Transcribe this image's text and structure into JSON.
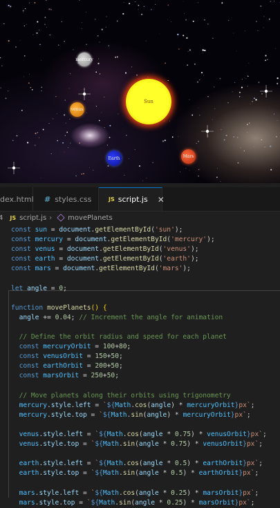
{
  "planets": {
    "sun": "Sun",
    "mercury": "mercury",
    "venus": "venus",
    "earth": "Earth",
    "mars": "Mars"
  },
  "tabs": [
    {
      "label": "dex.html",
      "icon": "html-icon"
    },
    {
      "label": "styles.css",
      "icon": "hash-icon"
    },
    {
      "label": "script.js",
      "icon": "js-icon",
      "active": true
    }
  ],
  "breadcrumb": {
    "line": "4",
    "file": "script.js",
    "symbol": "movePlanets"
  },
  "code_lines": [
    [
      {
        "c": "kw",
        "t": "const "
      },
      {
        "c": "var",
        "t": "sun"
      },
      {
        "c": "",
        "t": " = "
      },
      {
        "c": "prop",
        "t": "document"
      },
      {
        "c": "",
        "t": "."
      },
      {
        "c": "fn",
        "t": "getElementById"
      },
      {
        "c": "",
        "t": "("
      },
      {
        "c": "str",
        "t": "'sun'"
      },
      {
        "c": "",
        "t": ");"
      }
    ],
    [
      {
        "c": "kw",
        "t": "const "
      },
      {
        "c": "var",
        "t": "mercury"
      },
      {
        "c": "",
        "t": " = "
      },
      {
        "c": "prop",
        "t": "document"
      },
      {
        "c": "",
        "t": "."
      },
      {
        "c": "fn",
        "t": "getElementById"
      },
      {
        "c": "",
        "t": "("
      },
      {
        "c": "str",
        "t": "'mercury'"
      },
      {
        "c": "",
        "t": ");"
      }
    ],
    [
      {
        "c": "kw",
        "t": "const "
      },
      {
        "c": "var",
        "t": "venus"
      },
      {
        "c": "",
        "t": " = "
      },
      {
        "c": "prop",
        "t": "document"
      },
      {
        "c": "",
        "t": "."
      },
      {
        "c": "fn",
        "t": "getElementById"
      },
      {
        "c": "",
        "t": "("
      },
      {
        "c": "str",
        "t": "'venus'"
      },
      {
        "c": "",
        "t": ");"
      }
    ],
    [
      {
        "c": "kw",
        "t": "const "
      },
      {
        "c": "var",
        "t": "earth"
      },
      {
        "c": "",
        "t": " = "
      },
      {
        "c": "prop",
        "t": "document"
      },
      {
        "c": "",
        "t": "."
      },
      {
        "c": "fn",
        "t": "getElementById"
      },
      {
        "c": "",
        "t": "("
      },
      {
        "c": "str",
        "t": "'earth'"
      },
      {
        "c": "",
        "t": ");"
      }
    ],
    [
      {
        "c": "kw",
        "t": "const "
      },
      {
        "c": "var",
        "t": "mars"
      },
      {
        "c": "",
        "t": " = "
      },
      {
        "c": "prop",
        "t": "document"
      },
      {
        "c": "",
        "t": "."
      },
      {
        "c": "fn",
        "t": "getElementById"
      },
      {
        "c": "",
        "t": "("
      },
      {
        "c": "str",
        "t": "'mars'"
      },
      {
        "c": "",
        "t": ");"
      }
    ],
    [],
    [
      {
        "c": "kw",
        "t": "let "
      },
      {
        "c": "prop",
        "t": "angle"
      },
      {
        "c": "",
        "t": " = "
      },
      {
        "c": "num",
        "t": "0"
      },
      {
        "c": "",
        "t": ";"
      }
    ],
    [],
    [
      {
        "c": "kw",
        "t": "function "
      },
      {
        "c": "fn",
        "t": "movePlanets"
      },
      {
        "c": "br",
        "t": "()"
      },
      {
        "c": "",
        "t": " "
      },
      {
        "c": "br",
        "t": "{"
      }
    ],
    [
      {
        "c": "",
        "t": "  "
      },
      {
        "c": "prop",
        "t": "angle"
      },
      {
        "c": "",
        "t": " += "
      },
      {
        "c": "num",
        "t": "0.04"
      },
      {
        "c": "",
        "t": "; "
      },
      {
        "c": "cm",
        "t": "// Increment the angle for animation"
      }
    ],
    [],
    [
      {
        "c": "",
        "t": "  "
      },
      {
        "c": "cm",
        "t": "// Define the orbit radius and speed for each planet"
      }
    ],
    [
      {
        "c": "",
        "t": "  "
      },
      {
        "c": "kw",
        "t": "const "
      },
      {
        "c": "var",
        "t": "mercuryOrbit"
      },
      {
        "c": "",
        "t": " = "
      },
      {
        "c": "num",
        "t": "100"
      },
      {
        "c": "",
        "t": "+"
      },
      {
        "c": "num",
        "t": "80"
      },
      {
        "c": "",
        "t": ";"
      }
    ],
    [
      {
        "c": "",
        "t": "  "
      },
      {
        "c": "kw",
        "t": "const "
      },
      {
        "c": "var",
        "t": "venusOrbit"
      },
      {
        "c": "",
        "t": " = "
      },
      {
        "c": "num",
        "t": "150"
      },
      {
        "c": "",
        "t": "+"
      },
      {
        "c": "num",
        "t": "50"
      },
      {
        "c": "",
        "t": ";"
      }
    ],
    [
      {
        "c": "",
        "t": "  "
      },
      {
        "c": "kw",
        "t": "const "
      },
      {
        "c": "var",
        "t": "earthOrbit"
      },
      {
        "c": "",
        "t": " = "
      },
      {
        "c": "num",
        "t": "200"
      },
      {
        "c": "",
        "t": "+"
      },
      {
        "c": "num",
        "t": "50"
      },
      {
        "c": "",
        "t": ";"
      }
    ],
    [
      {
        "c": "",
        "t": "  "
      },
      {
        "c": "kw",
        "t": "const "
      },
      {
        "c": "var",
        "t": "marsOrbit"
      },
      {
        "c": "",
        "t": " = "
      },
      {
        "c": "num",
        "t": "250"
      },
      {
        "c": "",
        "t": "+"
      },
      {
        "c": "num",
        "t": "50"
      },
      {
        "c": "",
        "t": ";"
      }
    ],
    [],
    [
      {
        "c": "",
        "t": "  "
      },
      {
        "c": "cm",
        "t": "// Move planets along their orbits using trigonometry"
      }
    ],
    [
      {
        "c": "",
        "t": "  "
      },
      {
        "c": "var",
        "t": "mercury"
      },
      {
        "c": "",
        "t": "."
      },
      {
        "c": "prop",
        "t": "style"
      },
      {
        "c": "",
        "t": "."
      },
      {
        "c": "prop",
        "t": "left"
      },
      {
        "c": "",
        "t": " = "
      },
      {
        "c": "str",
        "t": "`"
      },
      {
        "c": "kw",
        "t": "${"
      },
      {
        "c": "var",
        "t": "Math"
      },
      {
        "c": "",
        "t": "."
      },
      {
        "c": "fn",
        "t": "cos"
      },
      {
        "c": "",
        "t": "("
      },
      {
        "c": "prop",
        "t": "angle"
      },
      {
        "c": "",
        "t": ") * "
      },
      {
        "c": "var",
        "t": "mercuryOrbit"
      },
      {
        "c": "kw",
        "t": "}"
      },
      {
        "c": "str",
        "t": "px`"
      },
      {
        "c": "",
        "t": ";"
      }
    ],
    [
      {
        "c": "",
        "t": "  "
      },
      {
        "c": "var",
        "t": "mercury"
      },
      {
        "c": "",
        "t": "."
      },
      {
        "c": "prop",
        "t": "style"
      },
      {
        "c": "",
        "t": "."
      },
      {
        "c": "prop",
        "t": "top"
      },
      {
        "c": "",
        "t": " = "
      },
      {
        "c": "str",
        "t": "`"
      },
      {
        "c": "kw",
        "t": "${"
      },
      {
        "c": "var",
        "t": "Math"
      },
      {
        "c": "",
        "t": "."
      },
      {
        "c": "fn",
        "t": "sin"
      },
      {
        "c": "",
        "t": "("
      },
      {
        "c": "prop",
        "t": "angle"
      },
      {
        "c": "",
        "t": ") * "
      },
      {
        "c": "var",
        "t": "mercuryOrbit"
      },
      {
        "c": "kw",
        "t": "}"
      },
      {
        "c": "str",
        "t": "px`"
      },
      {
        "c": "",
        "t": ";"
      }
    ],
    [],
    [
      {
        "c": "",
        "t": "  "
      },
      {
        "c": "var",
        "t": "venus"
      },
      {
        "c": "",
        "t": "."
      },
      {
        "c": "prop",
        "t": "style"
      },
      {
        "c": "",
        "t": "."
      },
      {
        "c": "prop",
        "t": "left"
      },
      {
        "c": "",
        "t": " = "
      },
      {
        "c": "str",
        "t": "`"
      },
      {
        "c": "kw",
        "t": "${"
      },
      {
        "c": "var",
        "t": "Math"
      },
      {
        "c": "",
        "t": "."
      },
      {
        "c": "fn",
        "t": "cos"
      },
      {
        "c": "",
        "t": "("
      },
      {
        "c": "prop",
        "t": "angle"
      },
      {
        "c": "",
        "t": " * "
      },
      {
        "c": "num",
        "t": "0.75"
      },
      {
        "c": "",
        "t": ") * "
      },
      {
        "c": "var",
        "t": "venusOrbit"
      },
      {
        "c": "kw",
        "t": "}"
      },
      {
        "c": "str",
        "t": "px`"
      },
      {
        "c": "",
        "t": ";"
      }
    ],
    [
      {
        "c": "",
        "t": "  "
      },
      {
        "c": "var",
        "t": "venus"
      },
      {
        "c": "",
        "t": "."
      },
      {
        "c": "prop",
        "t": "style"
      },
      {
        "c": "",
        "t": "."
      },
      {
        "c": "prop",
        "t": "top"
      },
      {
        "c": "",
        "t": " = "
      },
      {
        "c": "str",
        "t": "`"
      },
      {
        "c": "kw",
        "t": "${"
      },
      {
        "c": "var",
        "t": "Math"
      },
      {
        "c": "",
        "t": "."
      },
      {
        "c": "fn",
        "t": "sin"
      },
      {
        "c": "",
        "t": "("
      },
      {
        "c": "prop",
        "t": "angle"
      },
      {
        "c": "",
        "t": " * "
      },
      {
        "c": "num",
        "t": "0.75"
      },
      {
        "c": "",
        "t": ") * "
      },
      {
        "c": "var",
        "t": "venusOrbit"
      },
      {
        "c": "kw",
        "t": "}"
      },
      {
        "c": "str",
        "t": "px`"
      },
      {
        "c": "",
        "t": ";"
      }
    ],
    [],
    [
      {
        "c": "",
        "t": "  "
      },
      {
        "c": "var",
        "t": "earth"
      },
      {
        "c": "",
        "t": "."
      },
      {
        "c": "prop",
        "t": "style"
      },
      {
        "c": "",
        "t": "."
      },
      {
        "c": "prop",
        "t": "left"
      },
      {
        "c": "",
        "t": " = "
      },
      {
        "c": "str",
        "t": "`"
      },
      {
        "c": "kw",
        "t": "${"
      },
      {
        "c": "var",
        "t": "Math"
      },
      {
        "c": "",
        "t": "."
      },
      {
        "c": "fn",
        "t": "cos"
      },
      {
        "c": "",
        "t": "("
      },
      {
        "c": "prop",
        "t": "angle"
      },
      {
        "c": "",
        "t": " * "
      },
      {
        "c": "num",
        "t": "0.5"
      },
      {
        "c": "",
        "t": ") * "
      },
      {
        "c": "var",
        "t": "earthOrbit"
      },
      {
        "c": "kw",
        "t": "}"
      },
      {
        "c": "str",
        "t": "px`"
      },
      {
        "c": "",
        "t": ";"
      }
    ],
    [
      {
        "c": "",
        "t": "  "
      },
      {
        "c": "var",
        "t": "earth"
      },
      {
        "c": "",
        "t": "."
      },
      {
        "c": "prop",
        "t": "style"
      },
      {
        "c": "",
        "t": "."
      },
      {
        "c": "prop",
        "t": "top"
      },
      {
        "c": "",
        "t": " = "
      },
      {
        "c": "str",
        "t": "`"
      },
      {
        "c": "kw",
        "t": "${"
      },
      {
        "c": "var",
        "t": "Math"
      },
      {
        "c": "",
        "t": "."
      },
      {
        "c": "fn",
        "t": "sin"
      },
      {
        "c": "",
        "t": "("
      },
      {
        "c": "prop",
        "t": "angle"
      },
      {
        "c": "",
        "t": " * "
      },
      {
        "c": "num",
        "t": "0.5"
      },
      {
        "c": "",
        "t": ") * "
      },
      {
        "c": "var",
        "t": "earthOrbit"
      },
      {
        "c": "kw",
        "t": "}"
      },
      {
        "c": "str",
        "t": "px`"
      },
      {
        "c": "",
        "t": ";"
      }
    ],
    [],
    [
      {
        "c": "",
        "t": "  "
      },
      {
        "c": "var",
        "t": "mars"
      },
      {
        "c": "",
        "t": "."
      },
      {
        "c": "prop",
        "t": "style"
      },
      {
        "c": "",
        "t": "."
      },
      {
        "c": "prop",
        "t": "left"
      },
      {
        "c": "",
        "t": " = "
      },
      {
        "c": "str",
        "t": "`"
      },
      {
        "c": "kw",
        "t": "${"
      },
      {
        "c": "var",
        "t": "Math"
      },
      {
        "c": "",
        "t": "."
      },
      {
        "c": "fn",
        "t": "cos"
      },
      {
        "c": "",
        "t": "("
      },
      {
        "c": "prop",
        "t": "angle"
      },
      {
        "c": "",
        "t": " * "
      },
      {
        "c": "num",
        "t": "0.25"
      },
      {
        "c": "",
        "t": ") * "
      },
      {
        "c": "var",
        "t": "marsOrbit"
      },
      {
        "c": "kw",
        "t": "}"
      },
      {
        "c": "str",
        "t": "px`"
      },
      {
        "c": "",
        "t": ";"
      }
    ],
    [
      {
        "c": "",
        "t": "  "
      },
      {
        "c": "var",
        "t": "mars"
      },
      {
        "c": "",
        "t": "."
      },
      {
        "c": "prop",
        "t": "style"
      },
      {
        "c": "",
        "t": "."
      },
      {
        "c": "prop",
        "t": "top"
      },
      {
        "c": "",
        "t": " = "
      },
      {
        "c": "str",
        "t": "`"
      },
      {
        "c": "kw",
        "t": "${"
      },
      {
        "c": "var",
        "t": "Math"
      },
      {
        "c": "",
        "t": "."
      },
      {
        "c": "fn",
        "t": "sin"
      },
      {
        "c": "",
        "t": "("
      },
      {
        "c": "prop",
        "t": "angle"
      },
      {
        "c": "",
        "t": " * "
      },
      {
        "c": "num",
        "t": "0.25"
      },
      {
        "c": "",
        "t": ") * "
      },
      {
        "c": "var",
        "t": "marsOrbit"
      },
      {
        "c": "kw",
        "t": "}"
      },
      {
        "c": "str",
        "t": "px`"
      },
      {
        "c": "",
        "t": ";"
      }
    ]
  ],
  "colors": {
    "sun": "#ffff00",
    "mercury": "#a0a0a0",
    "venus": "#ff9900",
    "earth": "#1a24e0",
    "mars": "#ff4a1a",
    "accent": "#0078d4"
  }
}
